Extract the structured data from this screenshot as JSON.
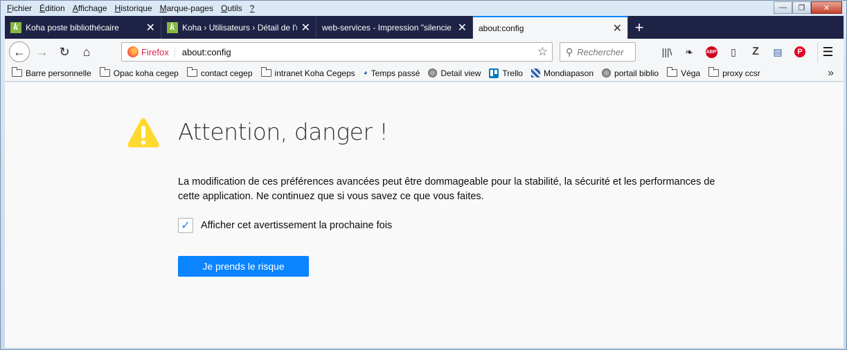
{
  "menubar": {
    "items": [
      {
        "first": "F",
        "rest": "ichier"
      },
      {
        "first": "É",
        "rest": "dition"
      },
      {
        "first": "A",
        "rest": "ffichage"
      },
      {
        "first": "H",
        "rest": "istorique"
      },
      {
        "first": "M",
        "rest": "arque-pages"
      },
      {
        "first": "O",
        "rest": "utils"
      },
      {
        "first": "?",
        "rest": ""
      }
    ]
  },
  "window_controls": {
    "minimize": "—",
    "maximize": "❐",
    "close": "✕"
  },
  "tabs": [
    {
      "label": "Koha poste bibliothécaire",
      "icon": "k"
    },
    {
      "label": "Koha › Utilisateurs › Détail de l'u",
      "icon": "k"
    },
    {
      "label": "web-services - Impression \"silencie",
      "icon": ""
    },
    {
      "label": "about:config",
      "icon": ""
    }
  ],
  "tab_close": "✕",
  "new_tab": "+",
  "nav": {
    "back": "←",
    "forward": "→",
    "reload": "↻",
    "home": "⌂",
    "identity_label": "Firefox",
    "url": "about:config",
    "star": "☆",
    "search_placeholder": "Rechercher",
    "search_glyph": "⚲",
    "menu": "☰"
  },
  "toolbar_icons": {
    "library": "|||\\",
    "feather": "❧",
    "abp": "ABP",
    "sidebar": "▯",
    "zotero": "Z",
    "reader": "▤",
    "pinterest": "P"
  },
  "bookmarks": [
    {
      "label": "Barre personnelle",
      "icon": "folder"
    },
    {
      "label": "Opac koha cegep",
      "icon": "folder"
    },
    {
      "label": "contact cegep",
      "icon": "folder"
    },
    {
      "label": "intranet Koha Cegeps",
      "icon": "folder"
    },
    {
      "label": "Temps passé",
      "icon": "temps"
    },
    {
      "label": "Detail view",
      "icon": "globe"
    },
    {
      "label": "Trello",
      "icon": "trello"
    },
    {
      "label": "Mondiapason",
      "icon": "mondia"
    },
    {
      "label": "portail biblio",
      "icon": "globe"
    },
    {
      "label": "Véga",
      "icon": "folder"
    },
    {
      "label": "proxy ccsr",
      "icon": "folder"
    }
  ],
  "bookmarks_overflow": "»",
  "page": {
    "heading": "Attention, danger !",
    "description": "La modification de ces préférences avancées peut être dommageable pour la stabilité, la sécurité et les performances de cette application. Ne continuez que si vous savez ce que vous faites.",
    "checkbox_label": "Afficher cet avertissement la prochaine fois",
    "checkbox_checked": true,
    "checkmark": "✓",
    "accept_button": "Je prends le risque"
  },
  "colors": {
    "accent": "#0a84ff",
    "tabstrip": "#1e2346",
    "warning": "#ffd92f"
  }
}
